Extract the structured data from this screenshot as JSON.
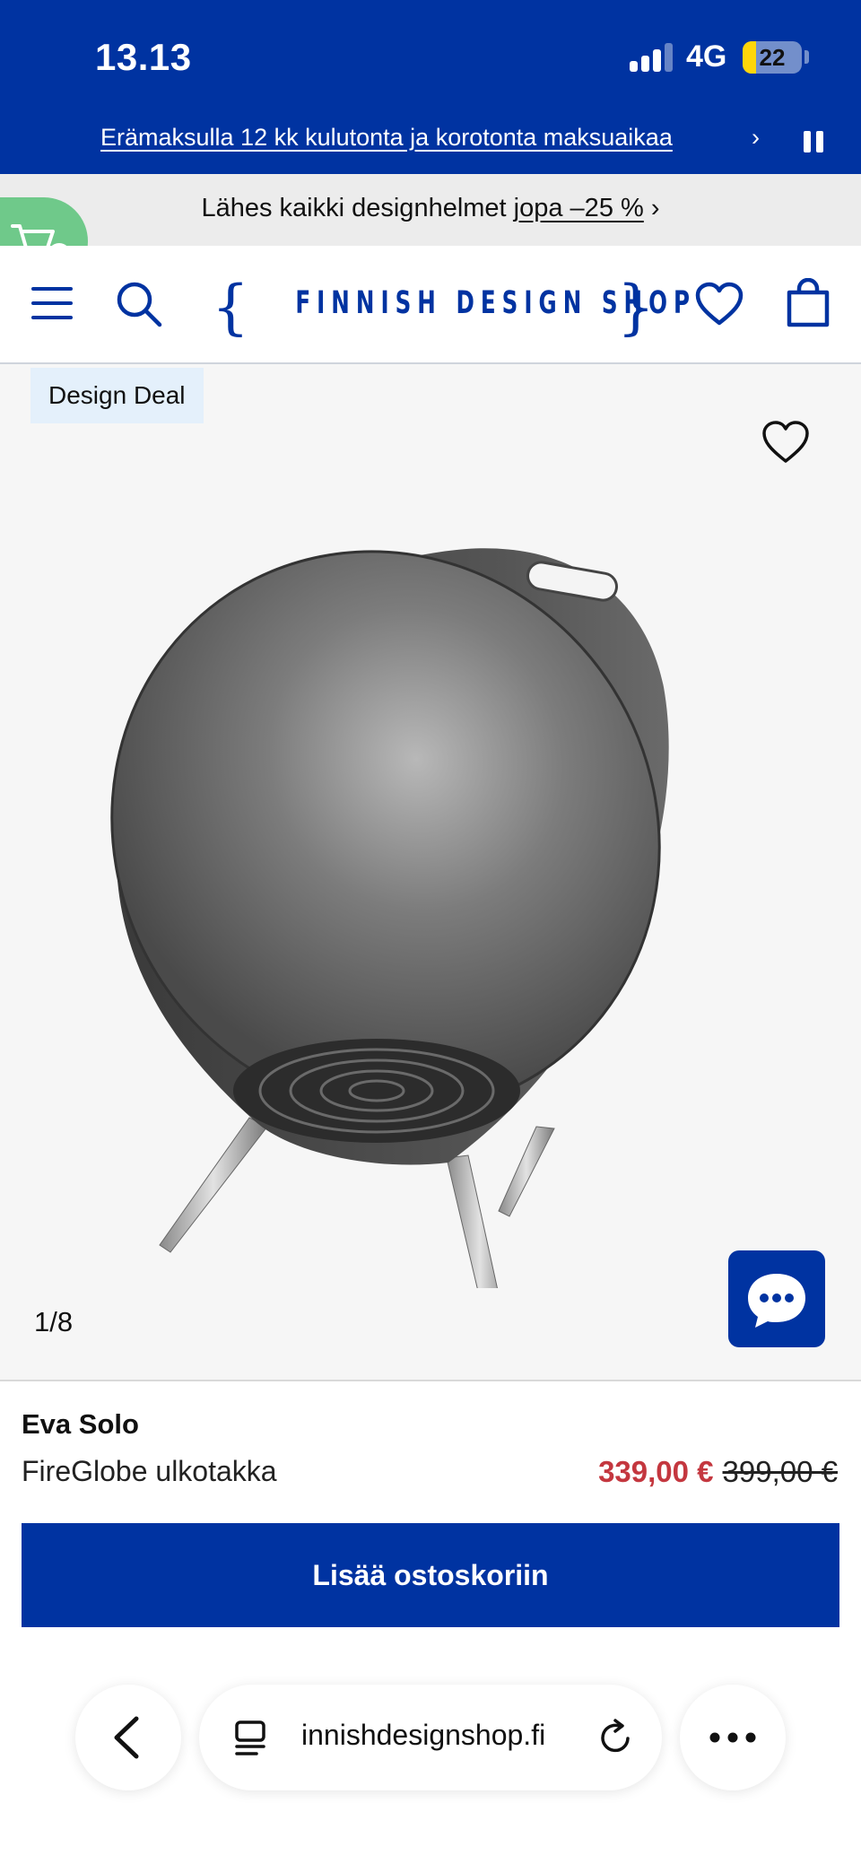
{
  "status_bar": {
    "time": "13.13",
    "network": "4G",
    "battery": "22",
    "battery_level": 0.22
  },
  "promo_banner": {
    "text": "Erämaksulla 12 kk kulutonta ja korotonta maksuaikaa",
    "chevron": "›",
    "pause_icon": "pause-icon"
  },
  "deal_strip": {
    "prefix": "Lähes kaikki designhelmet ",
    "link": "jopa –25 %",
    "chevron": " ›"
  },
  "header": {
    "logo": "FINNISH DESIGN SHOP",
    "brace_left": "{",
    "brace_right": "}",
    "icons": [
      "menu-icon",
      "search-icon",
      "heart-icon",
      "shopping-bag-icon"
    ]
  },
  "gallery": {
    "badge": "Design Deal",
    "counter": "1/8",
    "favorite_icon": "heart-icon",
    "chat_icon": "chat-icon"
  },
  "product": {
    "brand": "Eva Solo",
    "name": "FireGlobe ulkotakka",
    "price": "339,00 €",
    "old_price": "399,00 €",
    "add_to_cart": "Lisää ostoskoriin"
  },
  "browser_bar": {
    "url": "innishdesignshop.fi",
    "icons": [
      "back-icon",
      "tabs-icon",
      "reload-icon",
      "more-icon"
    ]
  },
  "colors": {
    "brand_blue": "#0033a1",
    "sale_red": "#c4373f",
    "cart_green": "#6fc98a"
  }
}
